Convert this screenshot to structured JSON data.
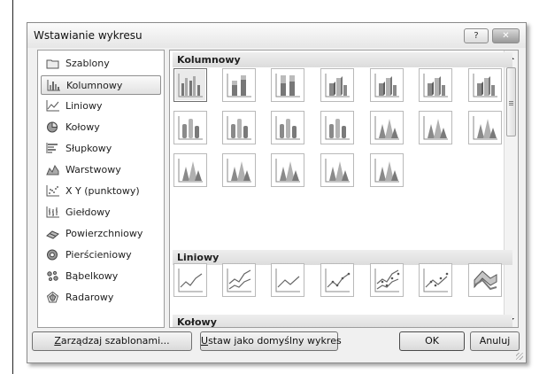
{
  "window": {
    "title": "Wstawianie wykresu",
    "help_glyph": "?",
    "close_glyph": "✕"
  },
  "categories": [
    {
      "label": "Szablony",
      "icon": "folder-icon",
      "selected": false
    },
    {
      "label": "Kolumnowy",
      "icon": "column-chart-icon",
      "selected": true
    },
    {
      "label": "Liniowy",
      "icon": "line-chart-icon",
      "selected": false
    },
    {
      "label": "Kołowy",
      "icon": "pie-chart-icon",
      "selected": false
    },
    {
      "label": "Słupkowy",
      "icon": "bar-chart-icon",
      "selected": false
    },
    {
      "label": "Warstwowy",
      "icon": "area-chart-icon",
      "selected": false
    },
    {
      "label": "X Y (punktowy)",
      "icon": "scatter-chart-icon",
      "selected": false
    },
    {
      "label": "Giełdowy",
      "icon": "stock-chart-icon",
      "selected": false
    },
    {
      "label": "Powierzchniowy",
      "icon": "surface-chart-icon",
      "selected": false
    },
    {
      "label": "Pierścieniowy",
      "icon": "doughnut-chart-icon",
      "selected": false
    },
    {
      "label": "Bąbelkowy",
      "icon": "bubble-chart-icon",
      "selected": false
    },
    {
      "label": "Radarowy",
      "icon": "radar-chart-icon",
      "selected": false
    }
  ],
  "sections": [
    {
      "title": "Kolumnowy",
      "thumb_count": 19,
      "selected_index": 0
    },
    {
      "title": "Liniowy",
      "thumb_count": 7
    },
    {
      "title": "Kołowy",
      "thumb_count": 6
    }
  ],
  "buttons": {
    "manage_templates": {
      "accel": "Z",
      "rest": "arządzaj szablonami..."
    },
    "set_default": {
      "accel": "U",
      "rest": "staw jako domyślny wykres"
    },
    "ok": "OK",
    "cancel": "Anuluj"
  }
}
